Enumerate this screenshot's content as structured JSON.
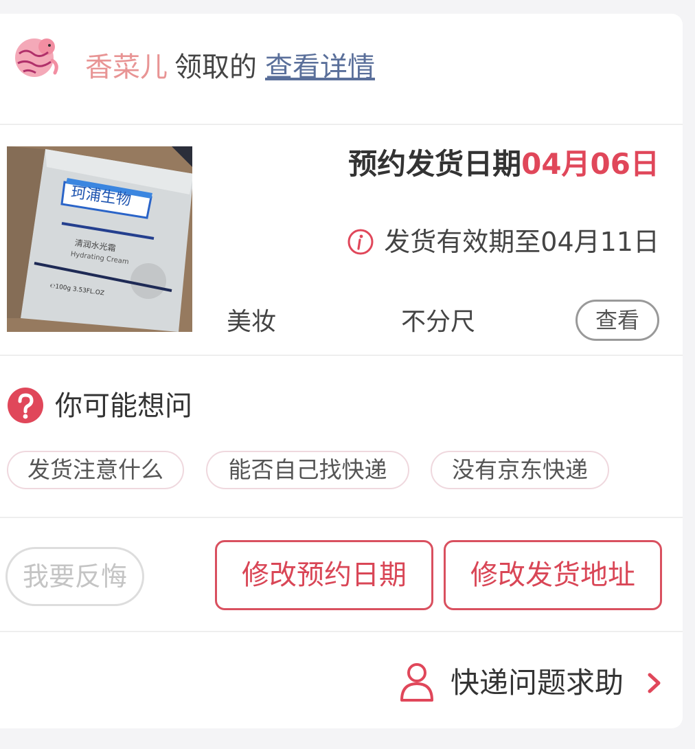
{
  "header": {
    "user_name": "香菜儿",
    "action_text": "领取的",
    "details_link": "查看详情"
  },
  "product": {
    "image_alt": "珂浦生物 清润水光霜 Hydrating Cream",
    "image_text": {
      "brand": "珂浦生物",
      "name_cn": "清润水光霜",
      "name_en": "Hydrating Cream",
      "volume": "℮100g 3.53FL.OZ"
    },
    "ship_date_label": "预约发货日期",
    "ship_date_value": "04月06日",
    "validity_text": "发货有效期至04月11日",
    "category": "美妆",
    "size": "不分尺",
    "view_button": "查看"
  },
  "faq": {
    "title": "你可能想问",
    "chips": [
      "发货注意什么",
      "能否自己找快递",
      "没有京东快递"
    ]
  },
  "actions": {
    "regret": "我要反悔",
    "change_date": "修改预约日期",
    "change_address": "修改发货地址"
  },
  "footer": {
    "help_text": "快递问题求助"
  },
  "colors": {
    "accent": "#e0475a",
    "button_border": "#d9505f",
    "user_name": "#e89494",
    "link": "#5a6f9a"
  },
  "icons": {
    "avatar": "tiger-avatar-icon",
    "info": "info-circle-icon",
    "faq": "question-circle-icon",
    "help": "person-icon",
    "chevron": "chevron-right-icon"
  }
}
